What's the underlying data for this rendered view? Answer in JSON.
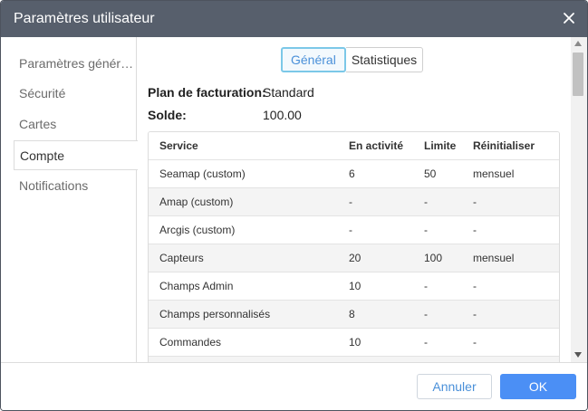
{
  "dialog": {
    "title": "Paramètres utilisateur"
  },
  "sidebar": {
    "items": [
      {
        "label": "Paramètres généraux"
      },
      {
        "label": "Sécurité"
      },
      {
        "label": "Cartes"
      },
      {
        "label": "Compte"
      },
      {
        "label": "Notifications"
      }
    ],
    "active_index": 3
  },
  "tabs": [
    {
      "label": "Général"
    },
    {
      "label": "Statistiques"
    }
  ],
  "account": {
    "billing_label": "Plan de facturation:",
    "billing_value": "Standard",
    "balance_label": "Solde:",
    "balance_value": "100.00"
  },
  "table": {
    "headers": [
      "Service",
      "En activité",
      "Limite",
      "Réinitialiser"
    ],
    "rows": [
      [
        "Seamap (custom)",
        "6",
        "50",
        "mensuel"
      ],
      [
        "Amap (custom)",
        "-",
        "-",
        "-"
      ],
      [
        "Arcgis (custom)",
        "-",
        "-",
        "-"
      ],
      [
        "Capteurs",
        "20",
        "100",
        "mensuel"
      ],
      [
        "Champs Admin",
        "10",
        "-",
        "-"
      ],
      [
        "Champs personnalisés",
        "8",
        "-",
        "-"
      ],
      [
        "Commandes",
        "10",
        "-",
        "-"
      ]
    ]
  },
  "footer": {
    "cancel_label": "Annuler",
    "ok_label": "OK"
  },
  "colors": {
    "titlebar": "#575f6c",
    "accent": "#4b8ff5",
    "tab_active": "#4a90d9"
  }
}
